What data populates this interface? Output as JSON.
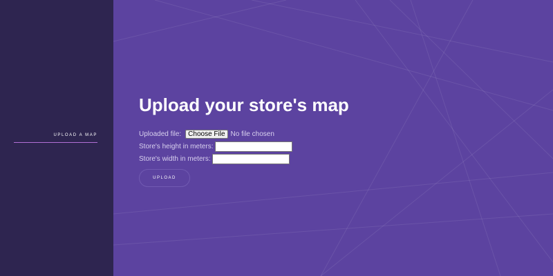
{
  "sidebar": {
    "nav_item_label": "UPLOAD A MAP"
  },
  "main": {
    "title": "Upload your store's map",
    "form": {
      "file_label": "Uploaded file:",
      "choose_file_label": "Choose File",
      "file_status": "No file chosen",
      "height_label": "Store's height in meters:",
      "height_value": "",
      "width_label": "Store's width in meters:",
      "width_value": "",
      "upload_label": "UPLOAD"
    }
  },
  "colors": {
    "sidebar_bg": "#2e2550",
    "main_bg": "#5c43a0",
    "nav_underline": "#b36fd6"
  }
}
